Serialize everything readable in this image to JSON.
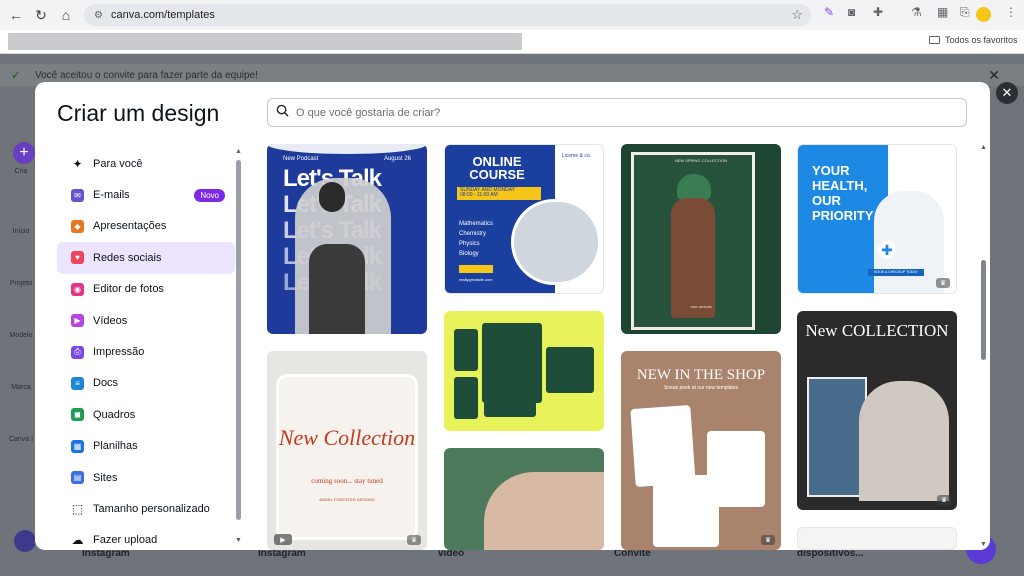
{
  "browser": {
    "url": "canva.com/templates",
    "bookmarks_folder": "Todos os favoritos"
  },
  "notice": {
    "text": "Você aceitou o convite para fazer parte da equipe!"
  },
  "background": {
    "side_labels": [
      "Cria",
      "Início",
      "Projeto",
      "Modelo",
      "Marca",
      "Canva I"
    ],
    "bottom_labels": [
      "Instagram",
      "Instagram",
      "vídeo",
      "Convite",
      "dispositivos..."
    ]
  },
  "modal": {
    "title": "Criar um design",
    "search_placeholder": "O que você gostaria de criar?",
    "menu": [
      {
        "label": "Para você",
        "icon": "sparkle-icon",
        "color": "#0e1318"
      },
      {
        "label": "E-mails",
        "icon": "email-icon",
        "color": "#6453d0",
        "badge": "Novo"
      },
      {
        "label": "Apresentações",
        "icon": "presentation-icon",
        "color": "#e8771e"
      },
      {
        "label": "Redes sociais",
        "icon": "heart-icon",
        "color": "#f0445a",
        "active": true
      },
      {
        "label": "Editor de fotos",
        "icon": "photo-editor-icon",
        "color": "#e3358a"
      },
      {
        "label": "Vídeos",
        "icon": "video-icon",
        "color": "#b546e4"
      },
      {
        "label": "Impressão",
        "icon": "printer-icon",
        "color": "#7b4ae8"
      },
      {
        "label": "Docs",
        "icon": "docs-icon",
        "color": "#1e88d8"
      },
      {
        "label": "Quadros",
        "icon": "whiteboard-icon",
        "color": "#1f9d55"
      },
      {
        "label": "Planilhas",
        "icon": "sheets-icon",
        "color": "#1a73e8"
      },
      {
        "label": "Sites",
        "icon": "website-icon",
        "color": "#3a6fe0"
      },
      {
        "label": "Tamanho personalizado",
        "icon": "custom-size-icon",
        "color": "#0e1318"
      },
      {
        "label": "Fazer upload",
        "icon": "upload-icon",
        "color": "#0e1318"
      }
    ],
    "templates": [
      {
        "name": "lets-talk-podcast",
        "top_left": "New Podcast",
        "top_right": "August 26",
        "headline": "Let's Talk"
      },
      {
        "name": "new-collection-torn",
        "headline": "New Collection",
        "sub": "coming soon... stay tuned",
        "small": "ANGEL FORESTER DESIGNS"
      },
      {
        "name": "online-course",
        "brand": "Licorne & co.",
        "headline": "ONLINE COURSE",
        "days": "SUNDAY AND MONDAY",
        "time": "08:00 - 11:00 AM",
        "subjects": [
          "Mathematics",
          "Chemistry",
          "Physics",
          "Biology"
        ],
        "site": "reallygreatsite.com"
      },
      {
        "name": "green-collage"
      },
      {
        "name": "green-portrait"
      },
      {
        "name": "new-spring-collection",
        "top": "NEW SPRING COLLECTION",
        "bottom": "new arrivals"
      },
      {
        "name": "new-in-the-shop",
        "headline": "NEW IN THE SHOP",
        "sub": "Sneak peek at our new templates"
      },
      {
        "name": "your-health",
        "headline": "YOUR HEALTH, OUR PRIORITY",
        "cta": "BOOK A CHECKUP TODAY"
      },
      {
        "name": "new-collection-collage",
        "headline": "New COLLECTION"
      },
      {
        "name": "white-card"
      }
    ]
  },
  "colors": {
    "accent": "#7d2ae8",
    "active_bg": "#ede4ff",
    "podcast_blue": "#1e3a9a",
    "course_blue": "#1b3f9e",
    "course_yellow": "#f5c518",
    "lime": "#e8f25a",
    "health_blue": "#1e88e5"
  }
}
